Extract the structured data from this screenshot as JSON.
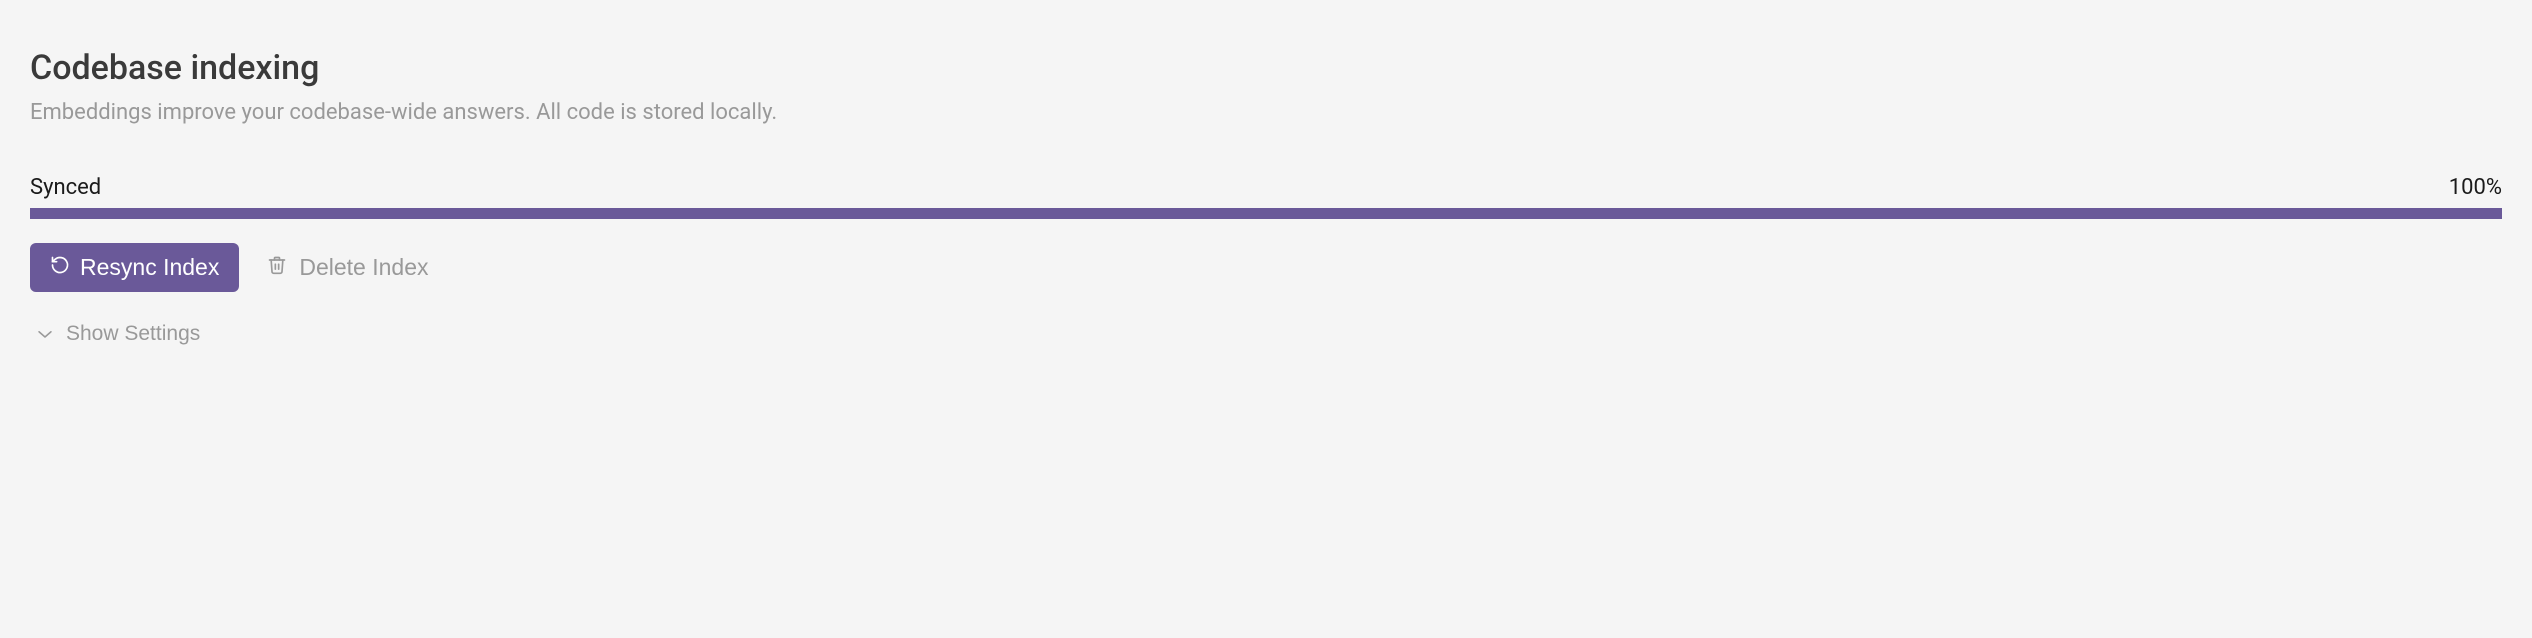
{
  "title": "Codebase indexing",
  "subtitle": "Embeddings improve your codebase-wide answers. All code is stored locally.",
  "status": {
    "label": "Synced",
    "percent_text": "100%",
    "percent_value": 100
  },
  "buttons": {
    "resync": "Resync Index",
    "delete": "Delete Index",
    "show_settings": "Show Settings"
  },
  "colors": {
    "accent": "#6a5999"
  }
}
